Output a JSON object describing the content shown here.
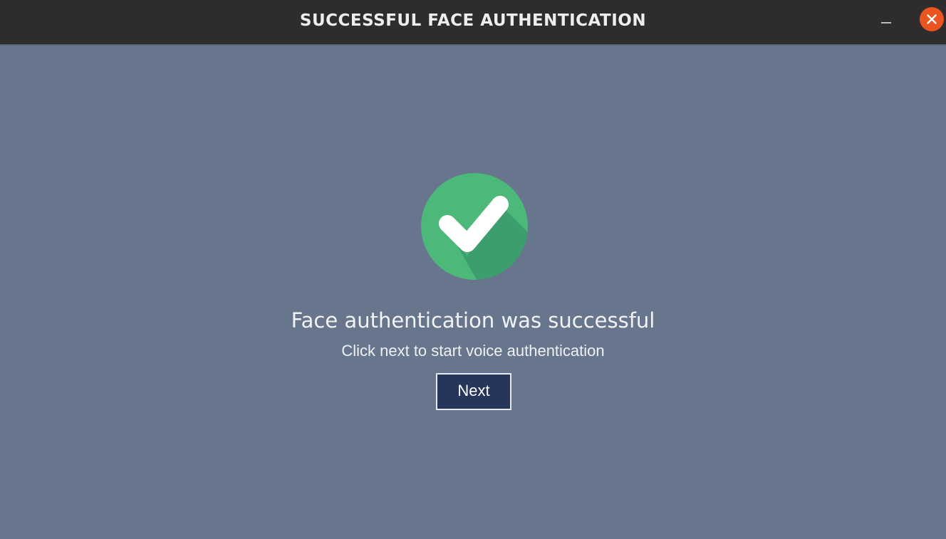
{
  "window": {
    "title": "SUCCESSFUL FACE AUTHENTICATION",
    "minimize_icon": "minimize-icon",
    "close_icon": "close-icon",
    "close_color": "#e95420"
  },
  "main": {
    "status_icon": "check-circle-icon",
    "status_color": "#4cb87a",
    "heading": "Face authentication was successful",
    "subtext": "Click next to start voice authentication",
    "next_label": "Next",
    "button_color": "#26355a",
    "background_color": "#67768c"
  }
}
